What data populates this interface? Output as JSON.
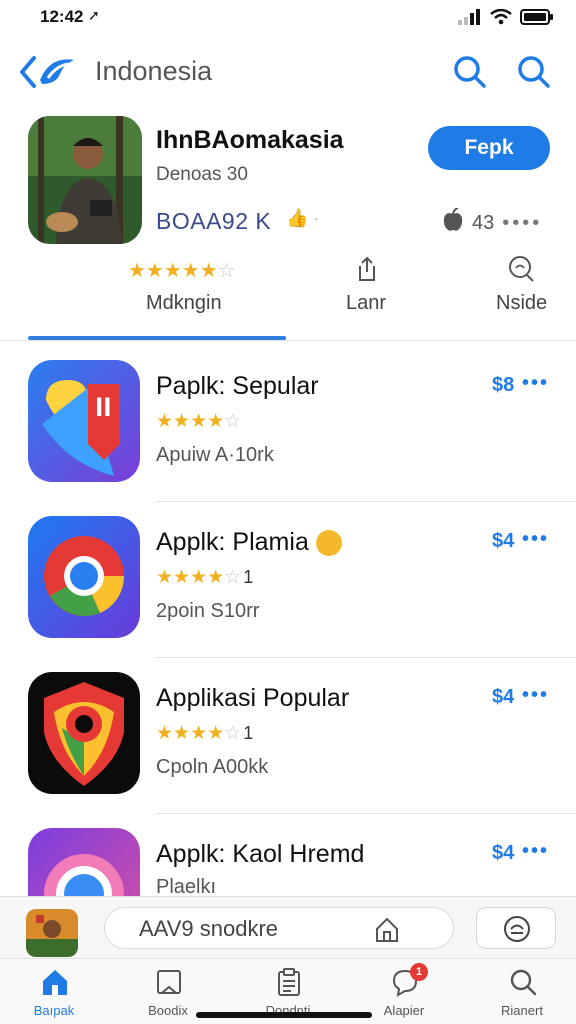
{
  "status": {
    "time": "12:42"
  },
  "nav": {
    "title": "Indonesia"
  },
  "featured": {
    "title": "IhnBAomakasia",
    "subtitle": "Denoas 30",
    "meta": "BOAA92 K",
    "button_label": "Fepk",
    "rating_count": "43"
  },
  "subtabs": [
    {
      "label": "Mdkngin"
    },
    {
      "label": "Lanr"
    },
    {
      "label": "Nside"
    }
  ],
  "apps": [
    {
      "name": "Paplk: Sepular",
      "subtitle": "Apuiw A·10rk",
      "price": "$8",
      "stars": 4,
      "count": ""
    },
    {
      "name": "Applk: Plamia",
      "subtitle": "2poin S10rr",
      "price": "$4",
      "stars": 4,
      "count": "1"
    },
    {
      "name": "Applikasi Popular",
      "subtitle": "Cpoln A00kk",
      "price": "$4",
      "stars": 4,
      "count": "1"
    },
    {
      "name": "Applk: Kaol Hremd",
      "subtitle": "Plaelkı",
      "price": "$4",
      "stars": 0,
      "count": ""
    }
  ],
  "mini": {
    "text": "AAV9 snodkre"
  },
  "tabbar": [
    {
      "label": "Baıpak",
      "icon": "home-icon",
      "active": true
    },
    {
      "label": "Boodix",
      "icon": "book-icon",
      "active": false
    },
    {
      "label": "Dondnti",
      "icon": "clipboard-icon",
      "active": false
    },
    {
      "label": "Alapier",
      "icon": "chat-icon",
      "active": false,
      "badge": "1"
    },
    {
      "label": "Rianert",
      "icon": "search-icon",
      "active": false
    }
  ],
  "colors": {
    "accent": "#1f7be6",
    "star": "#f2b01e"
  }
}
